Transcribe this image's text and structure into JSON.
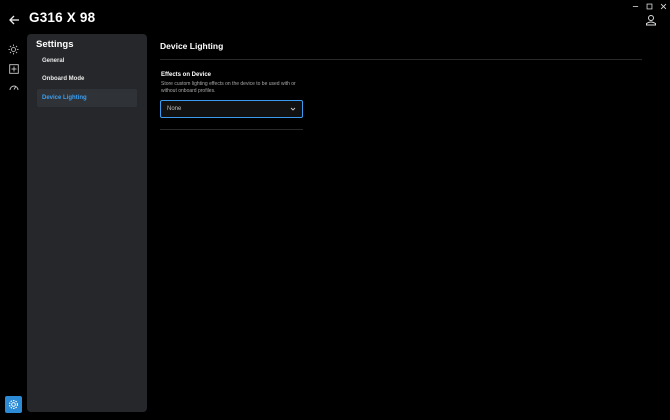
{
  "header": {
    "device_title": "G316 X 98"
  },
  "sidebar": {
    "title": "Settings",
    "items": [
      {
        "label": "General",
        "active": false
      },
      {
        "label": "Onboard Mode",
        "active": false
      },
      {
        "label": "Device Lighting",
        "active": true
      }
    ]
  },
  "main": {
    "title": "Device Lighting",
    "effects": {
      "label": "Effects on Device",
      "description": "Store custom lighting effects on the device to be used with or without onboard profiles.",
      "selected": "None"
    }
  },
  "icons": {
    "back": "arrow-left-icon",
    "account": "person-icon",
    "rail": [
      "sun-icon",
      "plus-square-icon",
      "gauge-icon"
    ],
    "settings": "gear-icon",
    "window": [
      "minimize-icon",
      "maximize-icon",
      "close-icon"
    ],
    "dropdown": "chevron-down-icon"
  },
  "colors": {
    "accent": "#2d8bd6",
    "active_text": "#3b9ff0",
    "panel": "#25272a",
    "background": "#000000"
  }
}
